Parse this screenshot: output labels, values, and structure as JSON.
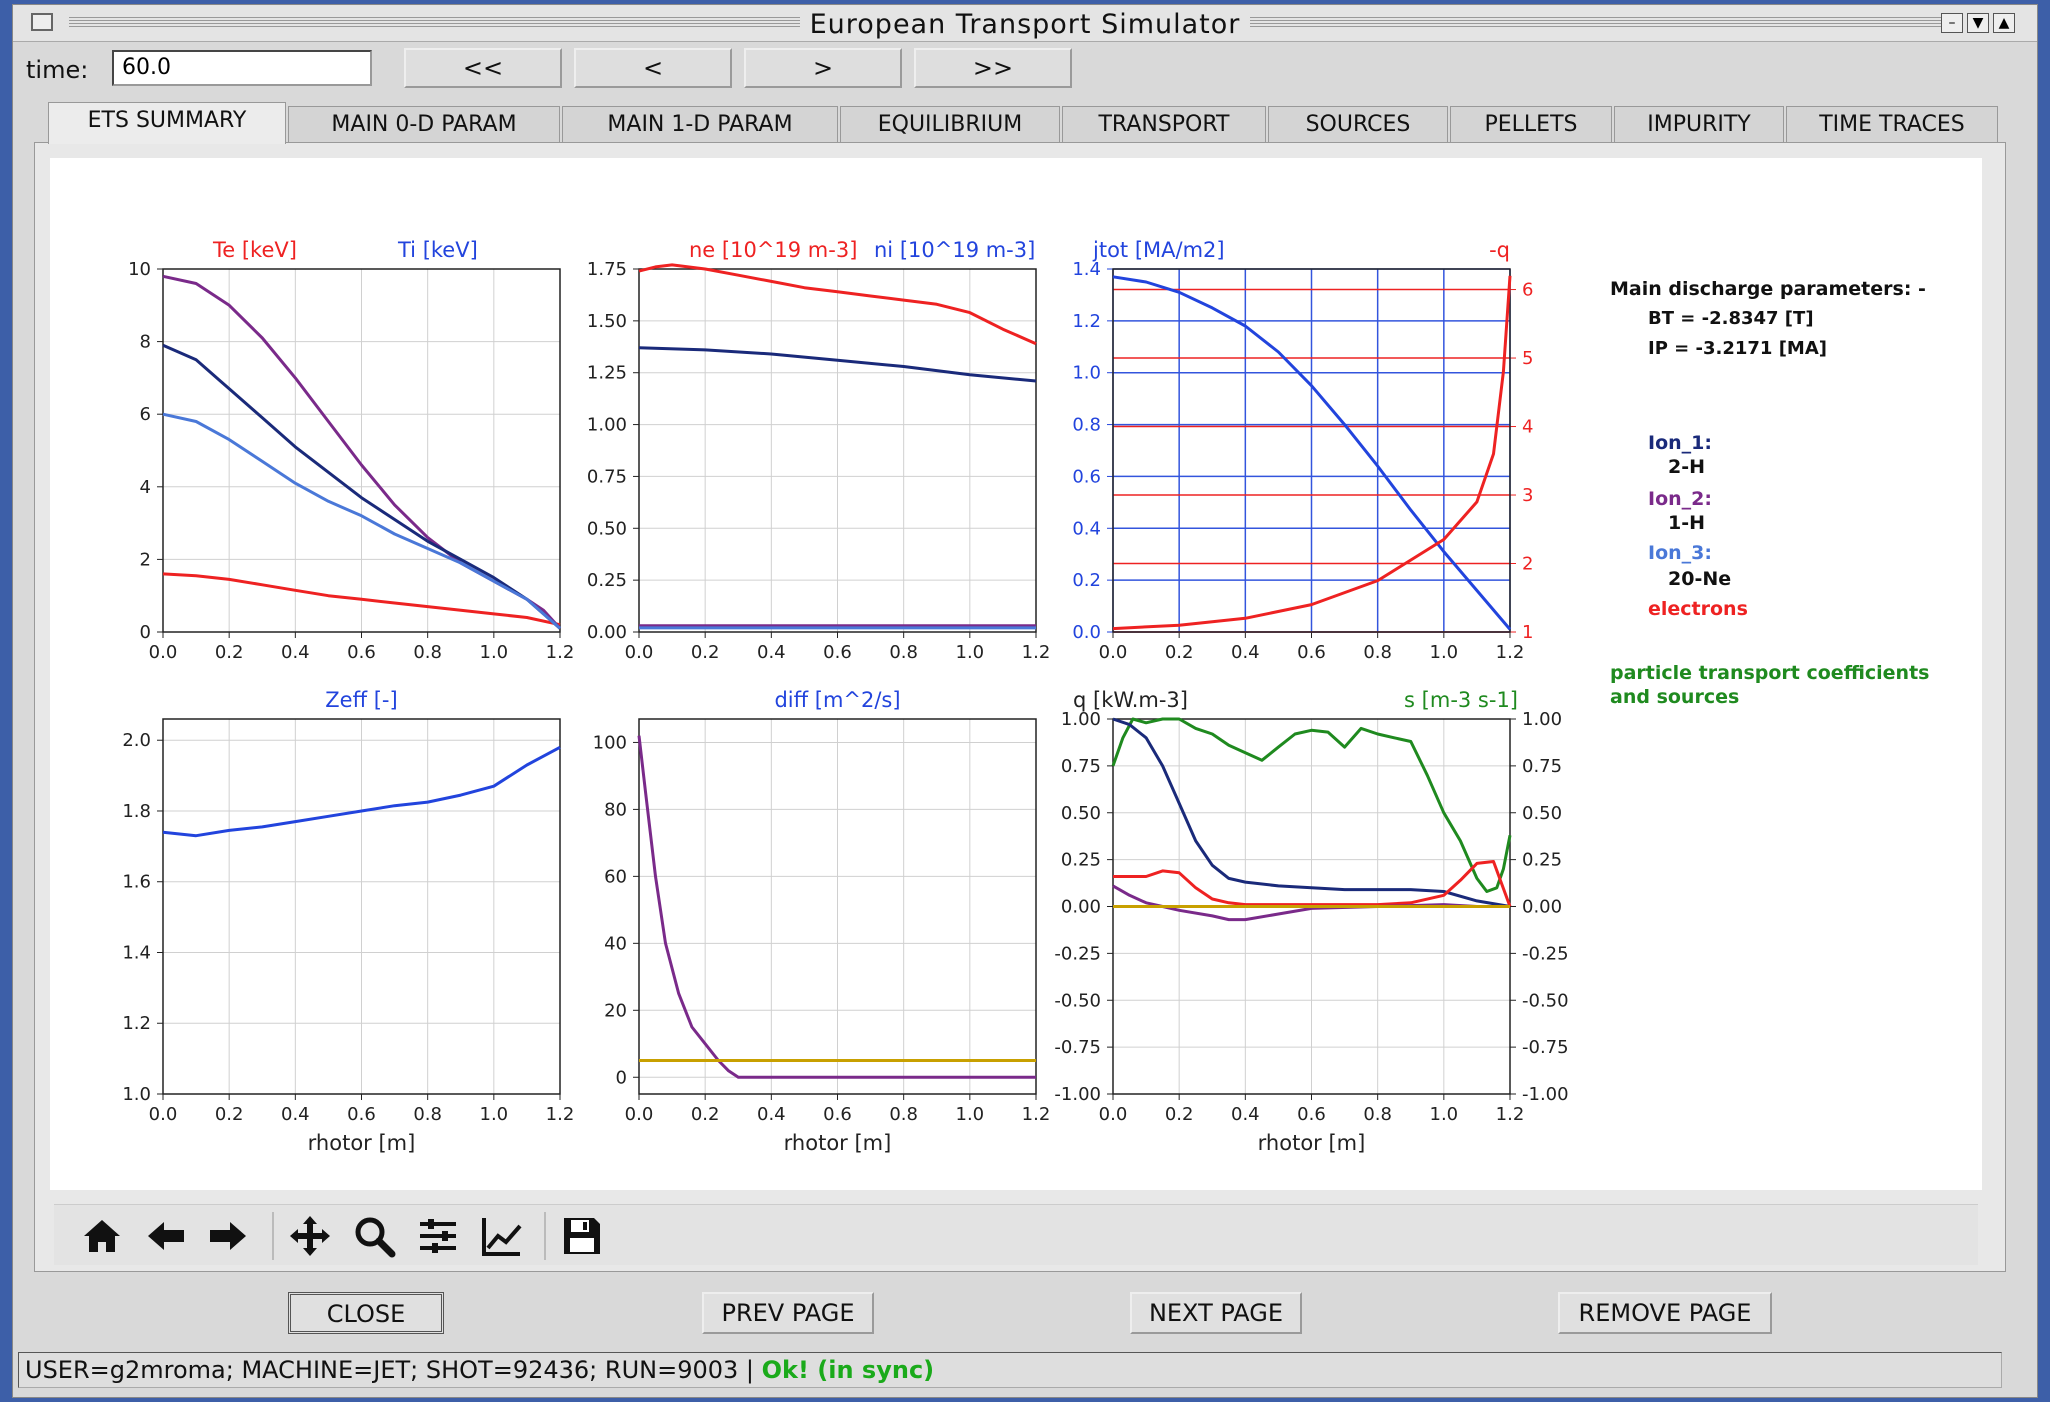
{
  "window": {
    "title": "European Transport Simulator"
  },
  "time": {
    "label": "time:",
    "value": "60.0"
  },
  "nav_buttons": [
    "<<",
    "<",
    ">",
    ">>"
  ],
  "tabs": [
    "ETS SUMMARY",
    "MAIN 0-D PARAM",
    "MAIN 1-D PARAM",
    "EQUILIBRIUM",
    "TRANSPORT",
    "SOURCES",
    "PELLETS",
    "IMPURITY",
    "TIME TRACES"
  ],
  "active_tab": "ETS SUMMARY",
  "colors": {
    "red": "#ee2222",
    "blue": "#2244dd",
    "navy": "#1a2a7a",
    "purple": "#7a2a8a",
    "lightblue": "#4a78d8",
    "green": "#1f8a1f",
    "olive": "#c8a000"
  },
  "info": {
    "title": "Main discharge parameters: -",
    "bt": "BT =  -2.8347 [T]",
    "ip": "IP =  -3.2171 [MA]",
    "ion1_label": "Ion_1:",
    "ion1_value": "2-H",
    "ion2_label": "Ion_2:",
    "ion2_value": "1-H",
    "ion3_label": "Ion_3:",
    "ion3_value": "20-Ne",
    "electrons": "electrons",
    "transport_note_1": "particle transport coefficients",
    "transport_note_2": "and sources"
  },
  "toolbar_icons": [
    "home-icon",
    "back-arrow-icon",
    "forward-arrow-icon",
    "pan-icon",
    "zoom-icon",
    "subplots-config-icon",
    "edit-curves-icon",
    "save-icon"
  ],
  "bottom_buttons": [
    "CLOSE",
    "PREV PAGE",
    "NEXT PAGE",
    "REMOVE PAGE"
  ],
  "status": {
    "text": "USER=g2mroma; MACHINE=JET; SHOT=92436; RUN=9003 | ",
    "ok": "Ok! (in sync)"
  },
  "chart_data": [
    {
      "type": "line",
      "title_left": "Te [keV]",
      "title_right": "Ti [keV]",
      "xlabel": "",
      "xlim": [
        0,
        1.2
      ],
      "ylim": [
        0,
        10
      ],
      "xticks": [
        "0.0",
        "0.2",
        "0.4",
        "0.6",
        "0.8",
        "1.0",
        "1.2"
      ],
      "yticks": [
        "0",
        "2",
        "4",
        "6",
        "8",
        "10"
      ],
      "series": [
        {
          "color": "#ee2222",
          "x": [
            0,
            0.1,
            0.2,
            0.3,
            0.4,
            0.5,
            0.6,
            0.7,
            0.8,
            0.9,
            1.0,
            1.1,
            1.2
          ],
          "y": [
            1.6,
            1.55,
            1.45,
            1.3,
            1.15,
            1.0,
            0.9,
            0.8,
            0.7,
            0.6,
            0.5,
            0.4,
            0.2
          ]
        },
        {
          "color": "#7a2a8a",
          "x": [
            0,
            0.1,
            0.2,
            0.3,
            0.4,
            0.5,
            0.6,
            0.7,
            0.8,
            0.9,
            1.0,
            1.1,
            1.15,
            1.2
          ],
          "y": [
            9.8,
            9.6,
            9.0,
            8.1,
            7.0,
            5.8,
            4.6,
            3.5,
            2.6,
            1.9,
            1.4,
            0.9,
            0.6,
            0.1
          ]
        },
        {
          "color": "#1a2a7a",
          "x": [
            0,
            0.1,
            0.2,
            0.3,
            0.4,
            0.5,
            0.6,
            0.7,
            0.8,
            0.9,
            1.0,
            1.1,
            1.2
          ],
          "y": [
            7.9,
            7.5,
            6.7,
            5.9,
            5.1,
            4.4,
            3.7,
            3.1,
            2.5,
            2.0,
            1.5,
            0.9,
            0.1
          ]
        },
        {
          "color": "#4a78d8",
          "x": [
            0,
            0.1,
            0.2,
            0.3,
            0.4,
            0.5,
            0.6,
            0.7,
            0.8,
            0.9,
            1.0,
            1.1,
            1.2
          ],
          "y": [
            6.0,
            5.8,
            5.3,
            4.7,
            4.1,
            3.6,
            3.2,
            2.7,
            2.3,
            1.9,
            1.4,
            0.9,
            0.1
          ]
        }
      ]
    },
    {
      "type": "line",
      "title_left": "ne [10^19 m-3]",
      "title_right": "ni [10^19 m-3]",
      "xlabel": "",
      "xlim": [
        0,
        1.2
      ],
      "ylim": [
        0,
        1.75
      ],
      "xticks": [
        "0.0",
        "0.2",
        "0.4",
        "0.6",
        "0.8",
        "1.0",
        "1.2"
      ],
      "yticks": [
        "0.00",
        "0.25",
        "0.50",
        "0.75",
        "1.00",
        "1.25",
        "1.50",
        "1.75"
      ],
      "series": [
        {
          "color": "#ee2222",
          "x": [
            0,
            0.05,
            0.1,
            0.2,
            0.3,
            0.4,
            0.5,
            0.6,
            0.7,
            0.8,
            0.9,
            1.0,
            1.1,
            1.2
          ],
          "y": [
            1.74,
            1.76,
            1.77,
            1.75,
            1.72,
            1.69,
            1.66,
            1.64,
            1.62,
            1.6,
            1.58,
            1.54,
            1.46,
            1.39
          ]
        },
        {
          "color": "#1a2a7a",
          "x": [
            0,
            0.2,
            0.4,
            0.6,
            0.8,
            1.0,
            1.2
          ],
          "y": [
            1.37,
            1.36,
            1.34,
            1.31,
            1.28,
            1.24,
            1.21
          ]
        },
        {
          "color": "#7a2a8a",
          "x": [
            0,
            1.2
          ],
          "y": [
            0.03,
            0.03
          ]
        },
        {
          "color": "#4a78d8",
          "x": [
            0,
            1.2
          ],
          "y": [
            0.02,
            0.02
          ]
        }
      ]
    },
    {
      "type": "line",
      "title_left": "jtot [MA/m2]",
      "title_right": "-q",
      "xlabel": "",
      "xlim": [
        0,
        1.2
      ],
      "ylim": [
        0,
        1.4
      ],
      "y2lim": [
        1,
        6.3
      ],
      "xticks": [
        "0.0",
        "0.2",
        "0.4",
        "0.6",
        "0.8",
        "1.0",
        "1.2"
      ],
      "yticks": [
        "0.0",
        "0.2",
        "0.4",
        "0.6",
        "0.8",
        "1.0",
        "1.2",
        "1.4"
      ],
      "y2ticks": [
        "1",
        "2",
        "3",
        "4",
        "5",
        "6"
      ],
      "series": [
        {
          "color": "#2244dd",
          "axis": "left",
          "x": [
            0,
            0.1,
            0.2,
            0.3,
            0.4,
            0.5,
            0.6,
            0.7,
            0.8,
            0.9,
            1.0,
            1.1,
            1.2
          ],
          "y": [
            1.37,
            1.35,
            1.31,
            1.25,
            1.18,
            1.08,
            0.95,
            0.8,
            0.64,
            0.47,
            0.31,
            0.16,
            0.01
          ]
        },
        {
          "color": "#ee2222",
          "axis": "right",
          "x": [
            0,
            0.2,
            0.4,
            0.6,
            0.8,
            1.0,
            1.1,
            1.15,
            1.18,
            1.2
          ],
          "y": [
            1.05,
            1.1,
            1.2,
            1.4,
            1.75,
            2.35,
            2.9,
            3.6,
            4.8,
            6.2
          ]
        }
      ]
    },
    {
      "type": "line",
      "title_left": "",
      "title_right": "Zeff [-]",
      "xlabel": "rhotor [m]",
      "xlim": [
        0,
        1.2
      ],
      "ylim": [
        1.0,
        2.06
      ],
      "xticks": [
        "0.0",
        "0.2",
        "0.4",
        "0.6",
        "0.8",
        "1.0",
        "1.2"
      ],
      "yticks": [
        "1.0",
        "1.2",
        "1.4",
        "1.6",
        "1.8",
        "2.0"
      ],
      "series": [
        {
          "color": "#2244dd",
          "x": [
            0,
            0.1,
            0.2,
            0.3,
            0.4,
            0.5,
            0.6,
            0.7,
            0.8,
            0.9,
            1.0,
            1.1,
            1.2
          ],
          "y": [
            1.74,
            1.73,
            1.745,
            1.755,
            1.77,
            1.785,
            1.8,
            1.815,
            1.825,
            1.845,
            1.87,
            1.93,
            1.98
          ]
        }
      ]
    },
    {
      "type": "line",
      "title_left": "",
      "title_right": "diff [m^2/s]",
      "xlabel": "rhotor [m]",
      "xlim": [
        0,
        1.2
      ],
      "ylim": [
        -5,
        107
      ],
      "xticks": [
        "0.0",
        "0.2",
        "0.4",
        "0.6",
        "0.8",
        "1.0",
        "1.2"
      ],
      "yticks": [
        "0",
        "20",
        "40",
        "60",
        "80",
        "100"
      ],
      "series": [
        {
          "color": "#7a2a8a",
          "x": [
            0,
            0.02,
            0.05,
            0.08,
            0.12,
            0.16,
            0.2,
            0.24,
            0.27,
            0.3,
            1.2
          ],
          "y": [
            102,
            85,
            60,
            40,
            25,
            15,
            10,
            5,
            2,
            0,
            0
          ]
        },
        {
          "color": "#c8a000",
          "x": [
            0,
            1.2
          ],
          "y": [
            5,
            5
          ]
        }
      ]
    },
    {
      "type": "line",
      "title_left": "q [kW.m-3]",
      "title_right": "s [m-3 s-1]",
      "xlabel": "rhotor [m]",
      "xlim": [
        0,
        1.2
      ],
      "ylim": [
        -1,
        1
      ],
      "y2lim": [
        -1,
        1
      ],
      "xticks": [
        "0.0",
        "0.2",
        "0.4",
        "0.6",
        "0.8",
        "1.0",
        "1.2"
      ],
      "yticks": [
        "-1.00",
        "-0.75",
        "-0.50",
        "-0.25",
        "0.00",
        "0.25",
        "0.50",
        "0.75",
        "1.00"
      ],
      "y2ticks": [
        "-1.00",
        "-0.75",
        "-0.50",
        "-0.25",
        "0.00",
        "0.25",
        "0.50",
        "0.75",
        "1.00"
      ],
      "series": [
        {
          "color": "#1f8a1f",
          "axis": "right",
          "x": [
            0,
            0.03,
            0.06,
            0.1,
            0.15,
            0.2,
            0.25,
            0.3,
            0.35,
            0.4,
            0.45,
            0.5,
            0.55,
            0.6,
            0.65,
            0.7,
            0.75,
            0.8,
            0.85,
            0.9,
            0.95,
            1.0,
            1.05,
            1.1,
            1.13,
            1.16,
            1.18,
            1.2
          ],
          "y": [
            0.75,
            0.9,
            1.0,
            0.98,
            1.0,
            1.0,
            0.95,
            0.92,
            0.86,
            0.82,
            0.78,
            0.85,
            0.92,
            0.94,
            0.93,
            0.85,
            0.95,
            0.92,
            0.9,
            0.88,
            0.7,
            0.5,
            0.35,
            0.15,
            0.08,
            0.1,
            0.2,
            0.38
          ]
        },
        {
          "color": "#1a2a7a",
          "axis": "left",
          "x": [
            0,
            0.05,
            0.1,
            0.15,
            0.2,
            0.25,
            0.3,
            0.35,
            0.4,
            0.5,
            0.6,
            0.7,
            0.8,
            0.9,
            1.0,
            1.1,
            1.2
          ],
          "y": [
            1.0,
            0.97,
            0.9,
            0.75,
            0.55,
            0.35,
            0.22,
            0.15,
            0.13,
            0.11,
            0.1,
            0.09,
            0.09,
            0.09,
            0.08,
            0.03,
            0.0
          ]
        },
        {
          "color": "#ee2222",
          "axis": "left",
          "x": [
            0,
            0.1,
            0.15,
            0.2,
            0.25,
            0.3,
            0.35,
            0.4,
            0.6,
            0.8,
            0.9,
            1.0,
            1.05,
            1.1,
            1.15,
            1.2
          ],
          "y": [
            0.16,
            0.16,
            0.19,
            0.18,
            0.1,
            0.04,
            0.02,
            0.01,
            0.01,
            0.01,
            0.02,
            0.06,
            0.14,
            0.23,
            0.24,
            0.0
          ]
        },
        {
          "color": "#7a2a8a",
          "axis": "left",
          "x": [
            0,
            0.05,
            0.1,
            0.15,
            0.2,
            0.3,
            0.35,
            0.4,
            0.5,
            0.6,
            0.8,
            1.0,
            1.1,
            1.2
          ],
          "y": [
            0.11,
            0.06,
            0.02,
            0.0,
            -0.02,
            -0.05,
            -0.07,
            -0.07,
            -0.04,
            -0.01,
            0.0,
            0.01,
            0.0,
            0.0
          ]
        },
        {
          "color": "#c8a000",
          "axis": "left",
          "x": [
            0,
            1.2
          ],
          "y": [
            0.0,
            0.0
          ]
        }
      ]
    }
  ]
}
